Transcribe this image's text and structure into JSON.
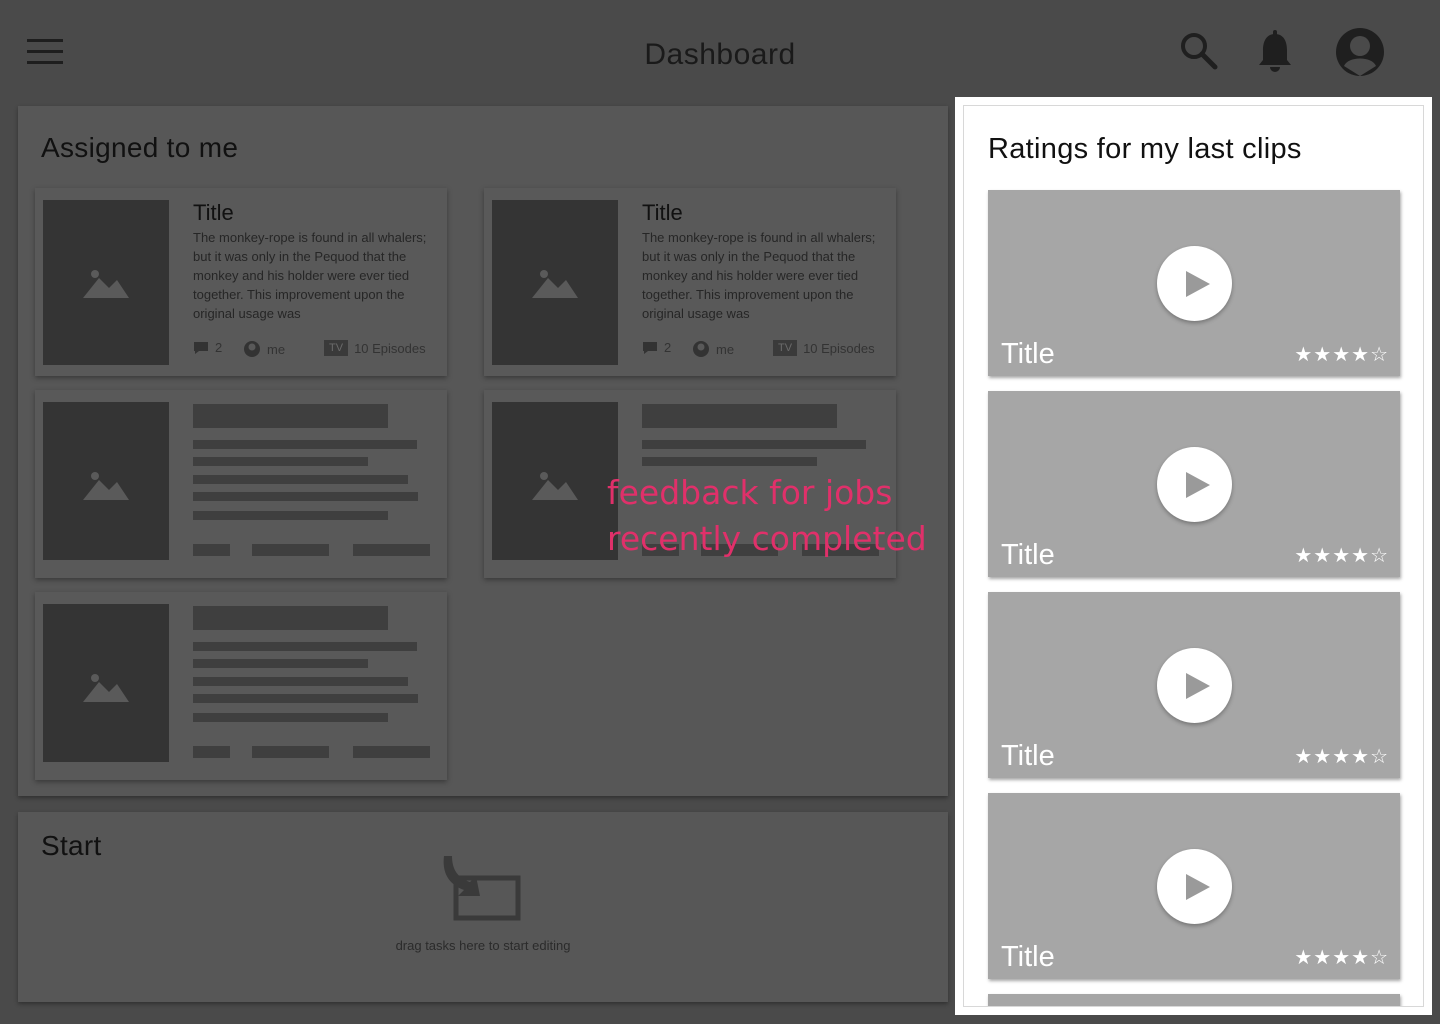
{
  "header": {
    "title": "Dashboard",
    "icons": [
      "menu-icon",
      "search-icon",
      "bell-icon",
      "avatar-icon"
    ]
  },
  "assigned": {
    "title": "Assigned to me",
    "cards": [
      {
        "title": "Title",
        "description": "The monkey-rope is found in all whalers; but it was only in the Pequod that the monkey and his holder were ever tied together. This improvement upon the original usage was",
        "comments": "2",
        "assignee": "me",
        "badge": "TV",
        "episodes": "10 Episodes"
      },
      {
        "title": "Title",
        "description": "The monkey-rope is found in all whalers; but it was only in the Pequod that the monkey and his holder were ever tied together. This improvement upon the original usage was",
        "comments": "2",
        "assignee": "me",
        "badge": "TV",
        "episodes": "10 Episodes"
      }
    ]
  },
  "annotation": {
    "line1": "feedback for jobs",
    "line2": "recently completed"
  },
  "start": {
    "title": "Start",
    "hint": "drag tasks here to start editing"
  },
  "ratings": {
    "title": "Ratings for my last clips",
    "clips": [
      {
        "title": "Title",
        "rating": 4,
        "max": 5
      },
      {
        "title": "Title",
        "rating": 4,
        "max": 5
      },
      {
        "title": "Title",
        "rating": 4,
        "max": 5
      },
      {
        "title": "Title",
        "rating": 4,
        "max": 5
      }
    ]
  },
  "colors": {
    "background": "#4a4a4a",
    "accent_annotation": "#e0306a",
    "clip_background": "#a6a6a6"
  }
}
